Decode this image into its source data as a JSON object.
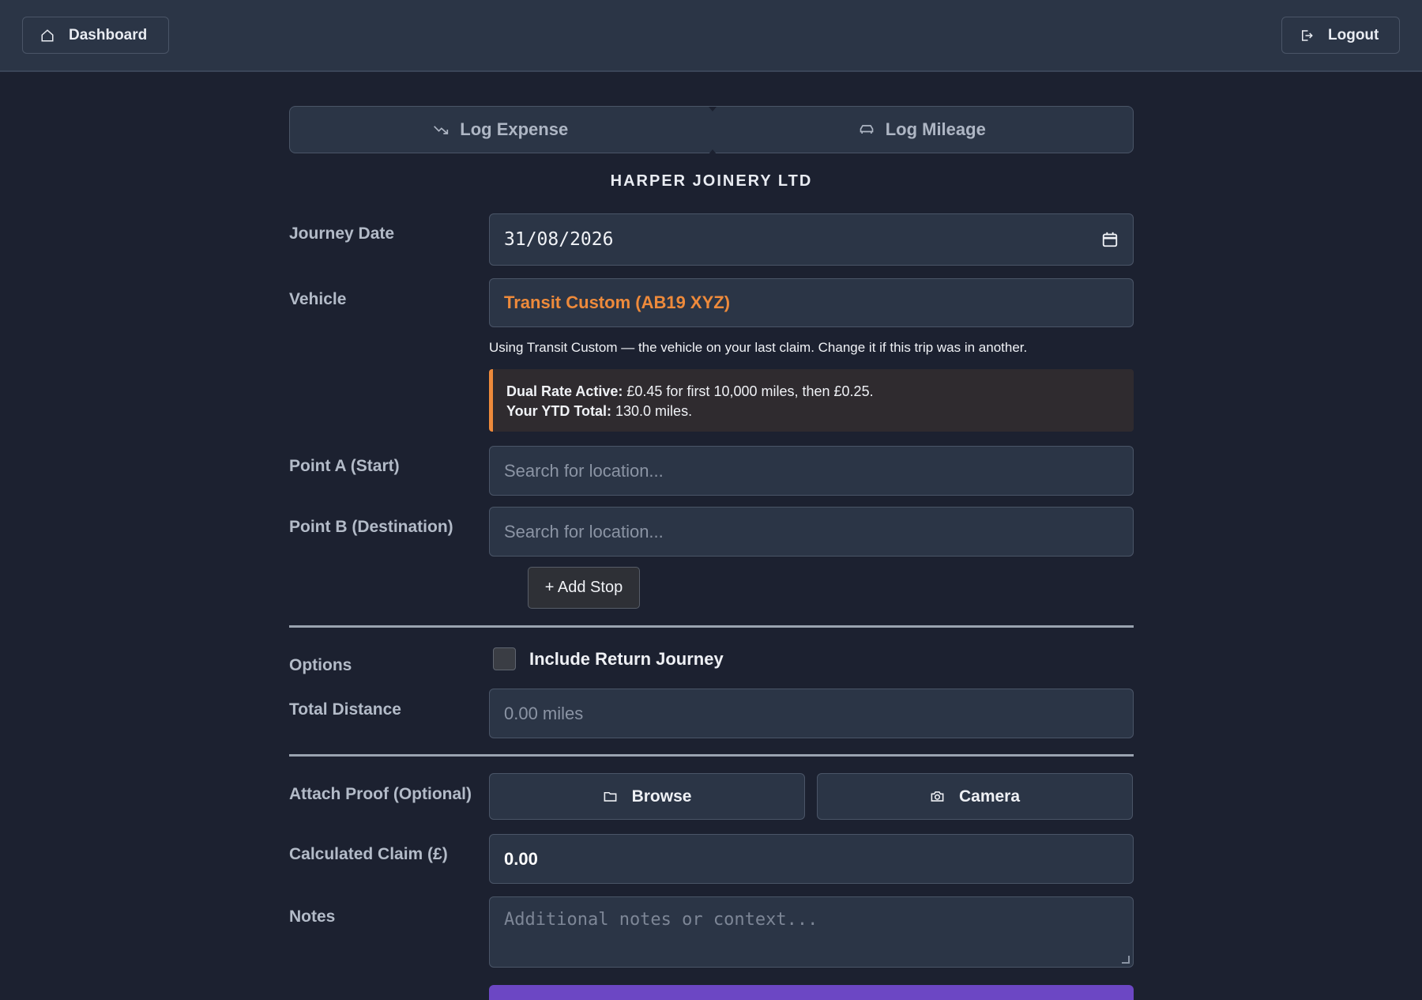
{
  "header": {
    "dashboard_label": "Dashboard",
    "logout_label": "Logout"
  },
  "tabs": [
    {
      "label": "Log Expense",
      "icon": "trending-down-icon"
    },
    {
      "label": "Log Mileage",
      "icon": "car-icon"
    }
  ],
  "company": "HARPER JOINERY LTD",
  "form": {
    "journey_date": {
      "label": "Journey Date",
      "value": "31/08/2026"
    },
    "vehicle": {
      "label": "Vehicle",
      "value": "Transit Custom (AB19 XYZ)",
      "hint": "Using Transit Custom — the vehicle on your last claim. Change it if this trip was in another."
    },
    "rate_info": {
      "dual_label": "Dual Rate Active:",
      "dual_text": "£0.45 for first 10,000 miles, then £0.25.",
      "ytd_label": "Your YTD Total:",
      "ytd_text": "130.0 miles."
    },
    "point_a": {
      "label": "Point A (Start)",
      "placeholder": "Search for location..."
    },
    "point_b": {
      "label": "Point B (Destination)",
      "placeholder": "Search for location..."
    },
    "add_stop_label": "+ Add Stop",
    "options": {
      "label": "Options",
      "return_label": "Include Return Journey",
      "return_checked": false
    },
    "total_distance": {
      "label": "Total Distance",
      "placeholder": "0.00 miles"
    },
    "attach": {
      "label": "Attach Proof (Optional)",
      "browse_label": "Browse",
      "camera_label": "Camera"
    },
    "claim": {
      "label": "Calculated Claim (£)",
      "value": "0.00"
    },
    "notes": {
      "label": "Notes",
      "placeholder": "Additional notes or context..."
    }
  },
  "colors": {
    "background": "#1c2130",
    "panel": "#2b3546",
    "accent_orange": "#ee8a3b",
    "submit_purple": "#6c47c4"
  }
}
